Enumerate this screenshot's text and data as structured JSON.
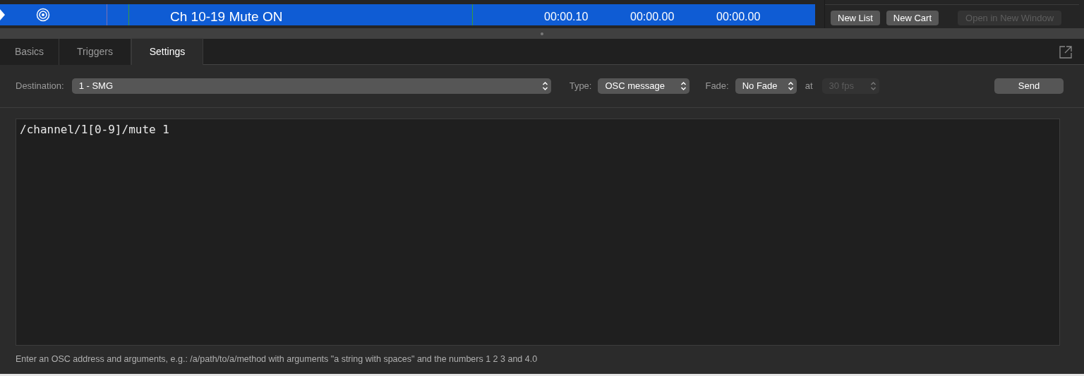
{
  "cue_row": {
    "name": "Ch 10-19 Mute ON",
    "selected": true,
    "times": [
      "00:00.10",
      "00:00.00",
      "00:00.00"
    ]
  },
  "list_buttons": [
    {
      "label": "New List",
      "disabled": false
    },
    {
      "label": "New Cart",
      "disabled": false
    },
    {
      "label": "Open in New Window",
      "disabled": true
    }
  ],
  "tabs": [
    {
      "label": "Basics",
      "selected": false
    },
    {
      "label": "Triggers",
      "selected": false
    },
    {
      "label": "Settings",
      "selected": true
    }
  ],
  "settings": {
    "destination": {
      "label": "Destination:",
      "value": "1 - SMG"
    },
    "type": {
      "label": "Type:",
      "value": "OSC message"
    },
    "fade": {
      "label": "Fade:",
      "value": "No Fade"
    },
    "rate": {
      "label": "at",
      "value": "30 fps",
      "disabled": true
    },
    "send": "Send"
  },
  "message": "/channel/1[0-9]/mute 1",
  "hint": "Enter an OSC address and arguments, e.g.: /a/path/to/a/method with arguments \"a string with spaces\" and the numbers 1 2 3 and 4.0"
}
